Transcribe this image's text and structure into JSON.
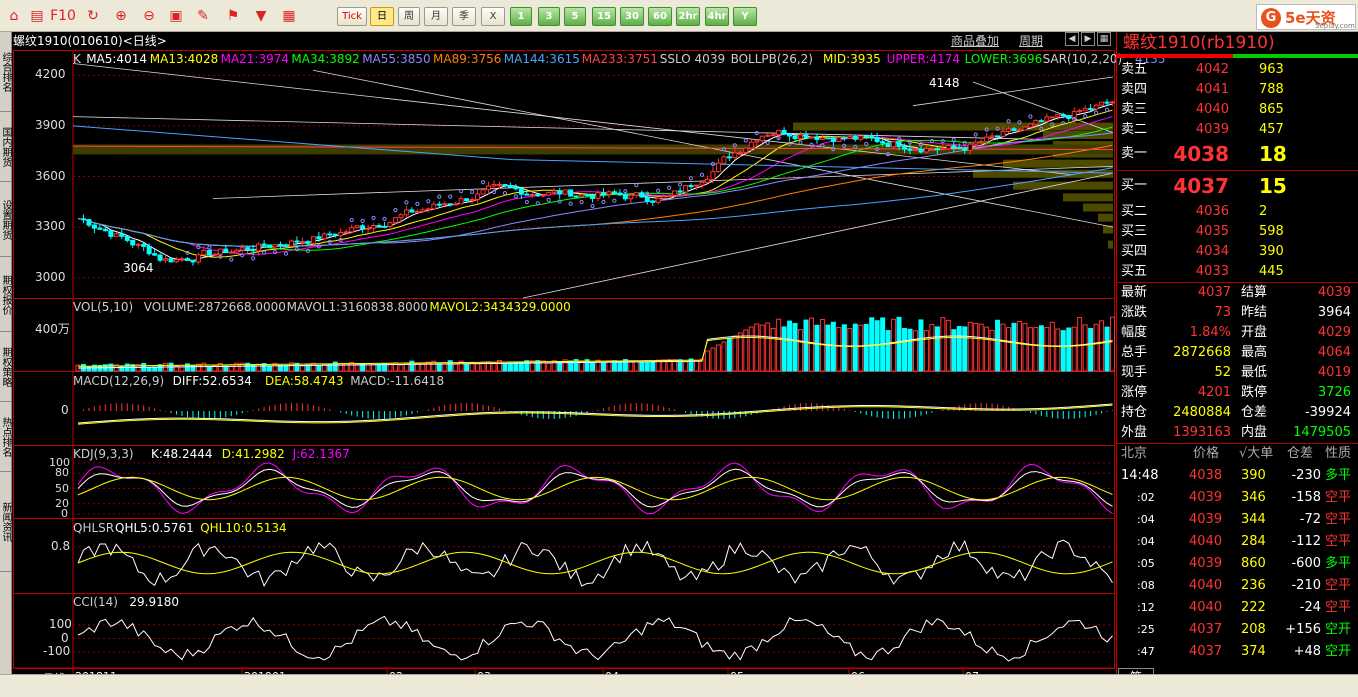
{
  "toolbar": {
    "buttons": [
      {
        "name": "home",
        "label": "⌂"
      },
      {
        "name": "news",
        "label": "▤"
      },
      {
        "name": "f10",
        "label": "F10"
      },
      {
        "name": "refresh",
        "label": "↻"
      },
      {
        "name": "zoom-in",
        "label": "⊕"
      },
      {
        "name": "zoom-out",
        "label": "⊖"
      },
      {
        "name": "overlay",
        "label": "▣"
      },
      {
        "name": "draw",
        "label": "✎"
      },
      {
        "name": "indicator",
        "label": "⚑"
      },
      {
        "name": "filter",
        "label": "▼"
      },
      {
        "name": "table",
        "label": "▦"
      },
      {
        "name": "trend",
        "label": "↗"
      },
      {
        "name": "tick",
        "label": "Tick"
      },
      {
        "name": "day",
        "label": "日"
      },
      {
        "name": "week",
        "label": "周"
      },
      {
        "name": "month",
        "label": "月"
      },
      {
        "name": "season",
        "label": "季"
      },
      {
        "name": "year",
        "label": "X"
      },
      {
        "name": "1m",
        "label": "1"
      },
      {
        "name": "3m",
        "label": "3"
      },
      {
        "name": "5m",
        "label": "5"
      },
      {
        "name": "15m",
        "label": "15"
      },
      {
        "name": "30m",
        "label": "30"
      },
      {
        "name": "60m",
        "label": "60"
      },
      {
        "name": "2hr",
        "label": "2hr"
      },
      {
        "name": "4hr",
        "label": "4hr"
      },
      {
        "name": "custom",
        "label": "Y"
      }
    ],
    "logo": {
      "main": "5e天资",
      "sub": "5eplay.com",
      "mark": "G"
    }
  },
  "lefttabs": [
    "综合排名",
    "国内期货",
    "设置期货",
    "期权报价",
    "期权策略",
    "热点排名",
    "新闻资讯"
  ],
  "chart": {
    "title": "螺纹1910(010610)<日线>",
    "top_links": [
      "商品叠加",
      "周期"
    ],
    "legends": {
      "k": [
        {
          "t": "K",
          "c": "#ddd"
        },
        {
          "t": "MA5:4014",
          "c": "#fff"
        },
        {
          "t": "MA13:4028",
          "c": "#ffff00"
        },
        {
          "t": "MA21:3974",
          "c": "#ff00ff"
        },
        {
          "t": "MA34:3892",
          "c": "#00ff00"
        },
        {
          "t": "MA55:3850",
          "c": "#8888ff"
        },
        {
          "t": "MA89:3756",
          "c": "#ff8000"
        },
        {
          "t": "MA144:3615",
          "c": "#4aa3ff"
        },
        {
          "t": "MA233:3751",
          "c": "#ff4444"
        },
        {
          "t": "SSLO 4039",
          "c": "#ccc"
        },
        {
          "t": "BOLLPB(26,2)",
          "c": "#ccc"
        },
        {
          "t": "MID:3935",
          "c": "#ffff00"
        },
        {
          "t": "UPPER:4174",
          "c": "#ff00ff"
        },
        {
          "t": "LOWER:3696",
          "c": "#00ff00"
        },
        {
          "t": "SAR(10,2,20)",
          "c": "#ccc"
        },
        {
          "t": "4135",
          "c": "#8888ff"
        }
      ],
      "vol": [
        {
          "t": "VOL(5,10)",
          "c": "#ccc"
        },
        {
          "t": "VOLUME:2872668.0000",
          "c": "#ccc"
        },
        {
          "t": "MAVOL1:3160838.8000",
          "c": "#ccc"
        },
        {
          "t": "MAVOL2:3434329.0000",
          "c": "#ffff00"
        }
      ],
      "macd": [
        {
          "t": "MACD(12,26,9)",
          "c": "#ccc"
        },
        {
          "t": "DIFF:52.6534",
          "c": "#fff"
        },
        {
          "t": "DEA:58.4743",
          "c": "#ffff00"
        },
        {
          "t": "MACD:-11.6418",
          "c": "#ccc"
        }
      ],
      "kdj": [
        {
          "t": "KDJ(9,3,3)",
          "c": "#ccc"
        },
        {
          "t": "K:48.2444",
          "c": "#fff"
        },
        {
          "t": "D:41.2982",
          "c": "#ffff00"
        },
        {
          "t": "J:62.1367",
          "c": "#ff00ff"
        }
      ],
      "qhlsr": [
        {
          "t": "QHLSR",
          "c": "#ccc"
        },
        {
          "t": "QHL5:0.5761",
          "c": "#fff"
        },
        {
          "t": "QHL10:0.5134",
          "c": "#ffff00"
        }
      ],
      "cci": [
        {
          "t": "CCI(14)",
          "c": "#ccc"
        },
        {
          "t": "29.9180",
          "c": "#fff"
        }
      ]
    },
    "yaxis": {
      "k": [
        "4200",
        "3900",
        "3600",
        "3300",
        "3000"
      ],
      "vol": [
        "400万"
      ],
      "macd": [
        "0"
      ],
      "kdj": [
        "100",
        "80",
        "50",
        "20",
        "0"
      ],
      "qhlsr": [
        "0.8"
      ],
      "cci": [
        "100",
        "0",
        "-100"
      ]
    },
    "xaxis": [
      "201811",
      "201901",
      "02",
      "03",
      "04",
      "05",
      "06",
      "07"
    ],
    "hi_label": "4148",
    "lo_label": "3064",
    "period_label": "日线"
  },
  "quote": {
    "title": "螺纹1910(rb1910)",
    "asks": [
      {
        "l": "卖五",
        "p": "4042",
        "v": "963"
      },
      {
        "l": "卖四",
        "p": "4041",
        "v": "788"
      },
      {
        "l": "卖三",
        "p": "4040",
        "v": "865"
      },
      {
        "l": "卖二",
        "p": "4039",
        "v": "457"
      },
      {
        "l": "卖一",
        "p": "4038",
        "v": "18"
      }
    ],
    "bids": [
      {
        "l": "买一",
        "p": "4037",
        "v": "15"
      },
      {
        "l": "买二",
        "p": "4036",
        "v": "2"
      },
      {
        "l": "买三",
        "p": "4035",
        "v": "598"
      },
      {
        "l": "买四",
        "p": "4034",
        "v": "390"
      },
      {
        "l": "买五",
        "p": "4033",
        "v": "445"
      }
    ],
    "stats": [
      {
        "l1": "最新",
        "v1": "4037",
        "c1": "#ff3333",
        "l2": "结算",
        "v2": "4039",
        "c2": "#ff3333"
      },
      {
        "l1": "涨跌",
        "v1": "73",
        "c1": "#ff3333",
        "l2": "昨结",
        "v2": "3964",
        "c2": "#fff"
      },
      {
        "l1": "幅度",
        "v1": "1.84%",
        "c1": "#ff3333",
        "l2": "开盘",
        "v2": "4029",
        "c2": "#ff3333"
      },
      {
        "l1": "总手",
        "v1": "2872668",
        "c1": "#ffff00",
        "l2": "最高",
        "v2": "4064",
        "c2": "#ff3333"
      },
      {
        "l1": "现手",
        "v1": "52",
        "c1": "#ffff00",
        "l2": "最低",
        "v2": "4019",
        "c2": "#ff3333"
      },
      {
        "l1": "涨停",
        "v1": "4201",
        "c1": "#ff3333",
        "l2": "跌停",
        "v2": "3726",
        "c2": "#00ff00"
      },
      {
        "l1": "持仓",
        "v1": "2480884",
        "c1": "#ffff00",
        "l2": "仓差",
        "v2": "-39924",
        "c2": "#fff"
      },
      {
        "l1": "外盘",
        "v1": "1393163",
        "c1": "#ff3333",
        "l2": "内盘",
        "v2": "1479505",
        "c2": "#00ff00"
      }
    ],
    "tick_header": [
      "北京",
      "价格",
      "√大单",
      "仓差",
      "性质"
    ],
    "ticks": [
      {
        "t": "14:48",
        "p": "4038",
        "v": "390",
        "d": "-230",
        "n": "多平",
        "nc": "#00ff00"
      },
      {
        "t": ":02",
        "p": "4039",
        "v": "346",
        "d": "-158",
        "n": "空平",
        "nc": "#ff3333"
      },
      {
        "t": ":04",
        "p": "4039",
        "v": "344",
        "d": "-72",
        "n": "空平",
        "nc": "#ff3333"
      },
      {
        "t": ":04",
        "p": "4040",
        "v": "284",
        "d": "-112",
        "n": "空平",
        "nc": "#ff3333"
      },
      {
        "t": ":05",
        "p": "4039",
        "v": "860",
        "d": "-600",
        "n": "多平",
        "nc": "#00ff00"
      },
      {
        "t": ":08",
        "p": "4040",
        "v": "236",
        "d": "-210",
        "n": "空平",
        "nc": "#ff3333"
      },
      {
        "t": ":12",
        "p": "4040",
        "v": "222",
        "d": "-24",
        "n": "空平",
        "nc": "#ff3333"
      },
      {
        "t": ":25",
        "p": "4037",
        "v": "208",
        "d": "+156",
        "n": "空开",
        "nc": "#00ff00"
      },
      {
        "t": ":47",
        "p": "4037",
        "v": "374",
        "d": "+48",
        "n": "空开",
        "nc": "#00ff00"
      }
    ],
    "tab": "笔"
  }
}
